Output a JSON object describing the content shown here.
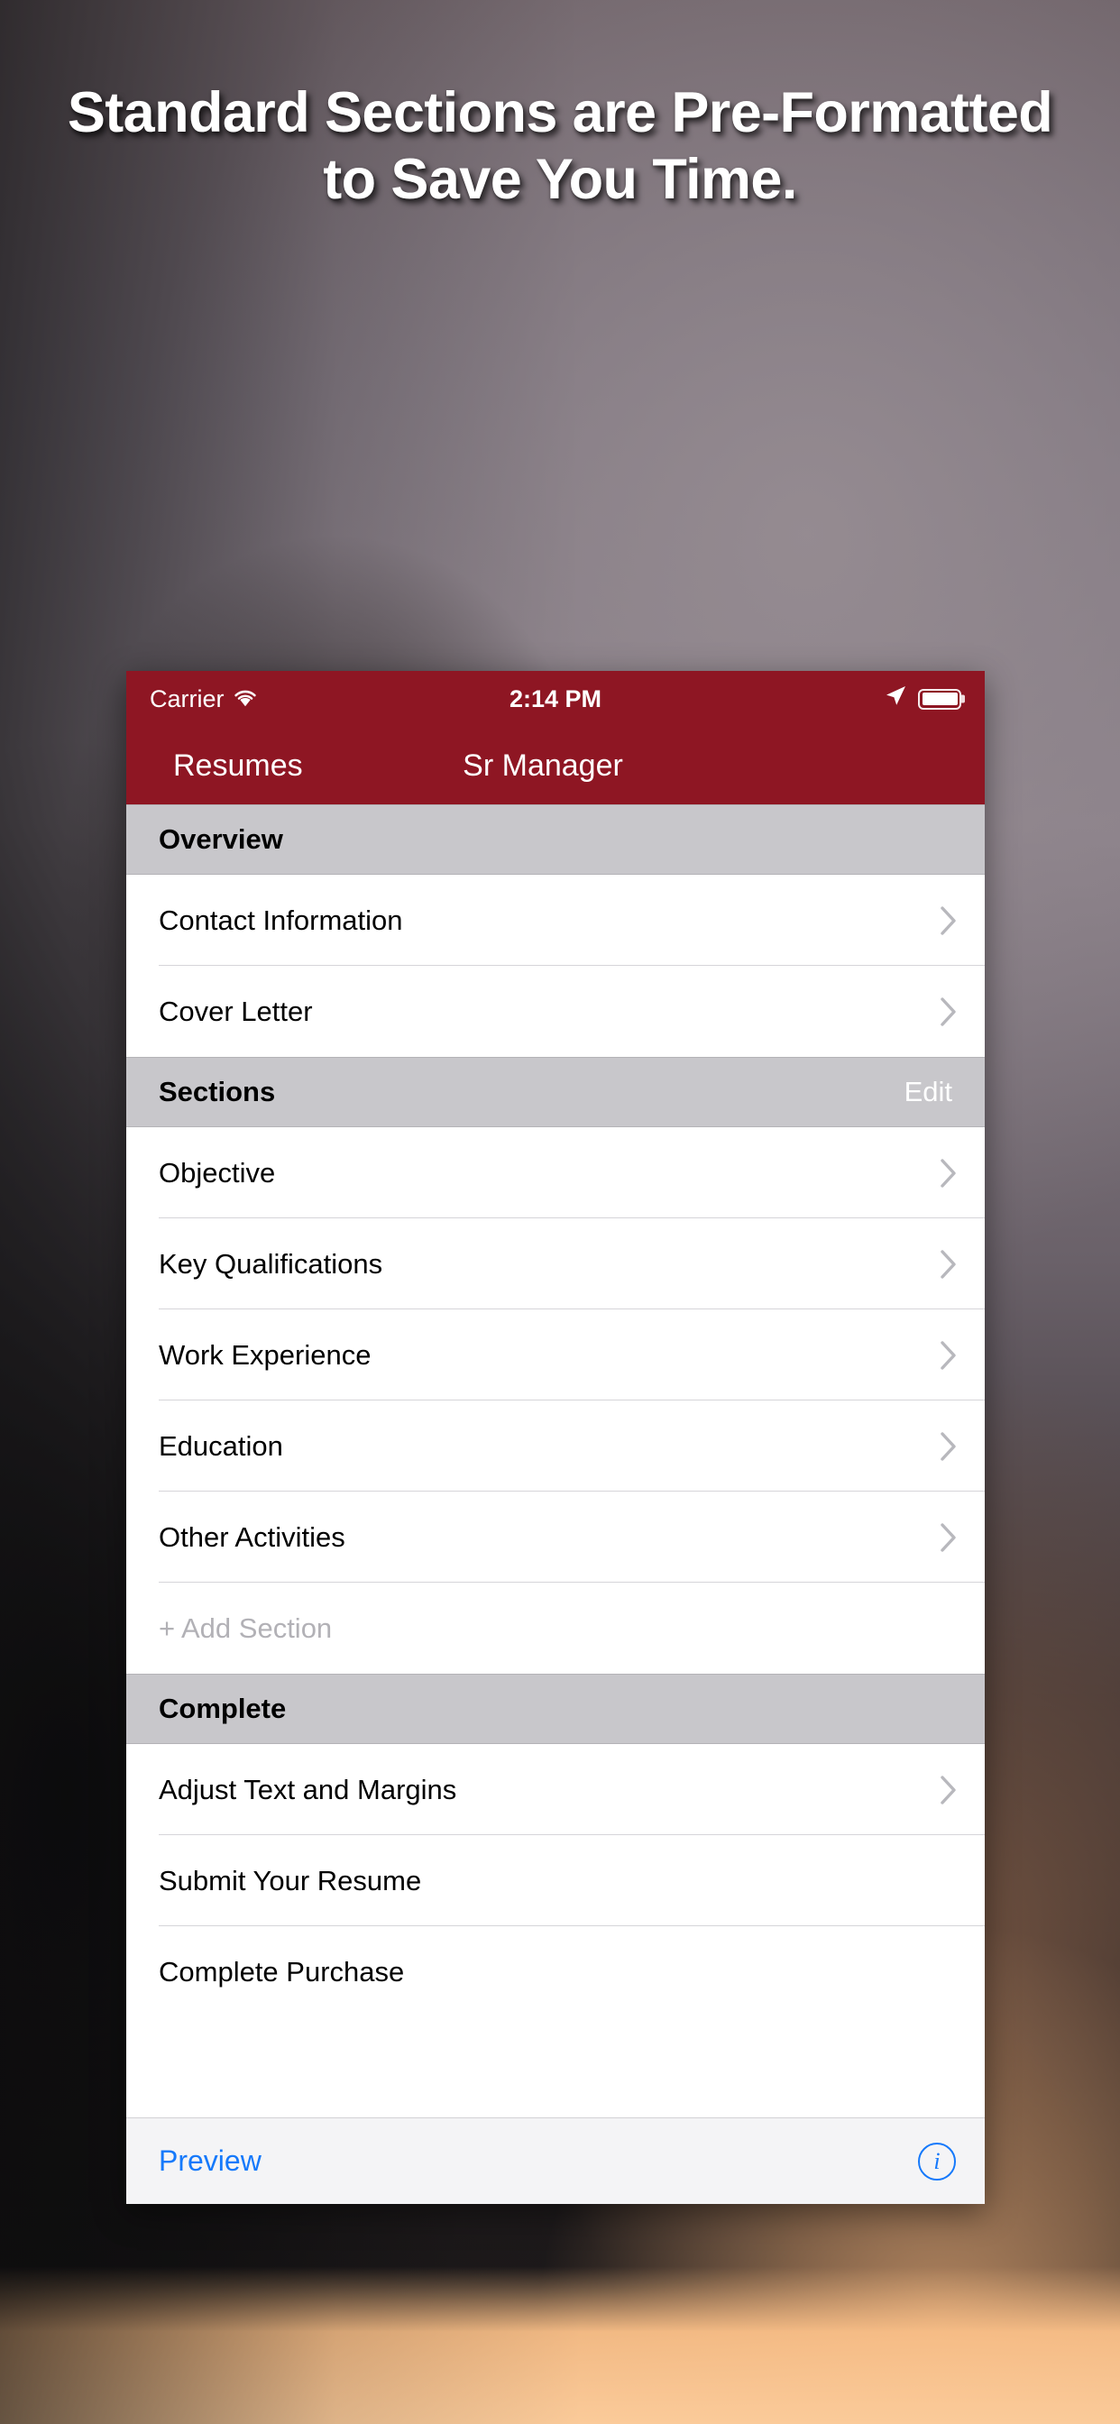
{
  "headline": "Standard Sections are Pre-Formatted to Save You Time.",
  "colors": {
    "nav_red": "#8E1623",
    "section_header_gray": "#c8c7cb",
    "link_blue": "#1579fb",
    "chevron_gray": "#b8b8bd",
    "muted_gray": "#b2b1b6",
    "toolbar_gray": "#f4f4f6"
  },
  "status_bar": {
    "carrier": "Carrier",
    "wifi_icon": "wifi-icon",
    "time": "2:14 PM",
    "location_icon": "location-arrow-icon",
    "battery_icon": "battery-full-icon"
  },
  "nav_bar": {
    "back_label": "Resumes",
    "title": "Sr Manager"
  },
  "sections": [
    {
      "header": "Overview",
      "action": null,
      "rows": [
        {
          "label": "Contact Information",
          "chevron": true,
          "muted": false
        },
        {
          "label": "Cover Letter",
          "chevron": true,
          "muted": false
        }
      ]
    },
    {
      "header": "Sections",
      "action": "Edit",
      "rows": [
        {
          "label": "Objective",
          "chevron": true,
          "muted": false
        },
        {
          "label": "Key Qualifications",
          "chevron": true,
          "muted": false
        },
        {
          "label": "Work Experience",
          "chevron": true,
          "muted": false
        },
        {
          "label": "Education",
          "chevron": true,
          "muted": false
        },
        {
          "label": "Other Activities",
          "chevron": true,
          "muted": false
        },
        {
          "label": "+ Add Section",
          "chevron": false,
          "muted": true
        }
      ]
    },
    {
      "header": "Complete",
      "action": null,
      "rows": [
        {
          "label": "Adjust Text and Margins",
          "chevron": true,
          "muted": false
        },
        {
          "label": "Submit Your Resume",
          "chevron": false,
          "muted": false
        },
        {
          "label": "Complete Purchase",
          "chevron": false,
          "muted": false
        }
      ]
    }
  ],
  "toolbar": {
    "preview_label": "Preview",
    "info_icon": "info-circle-icon",
    "info_glyph": "i"
  }
}
